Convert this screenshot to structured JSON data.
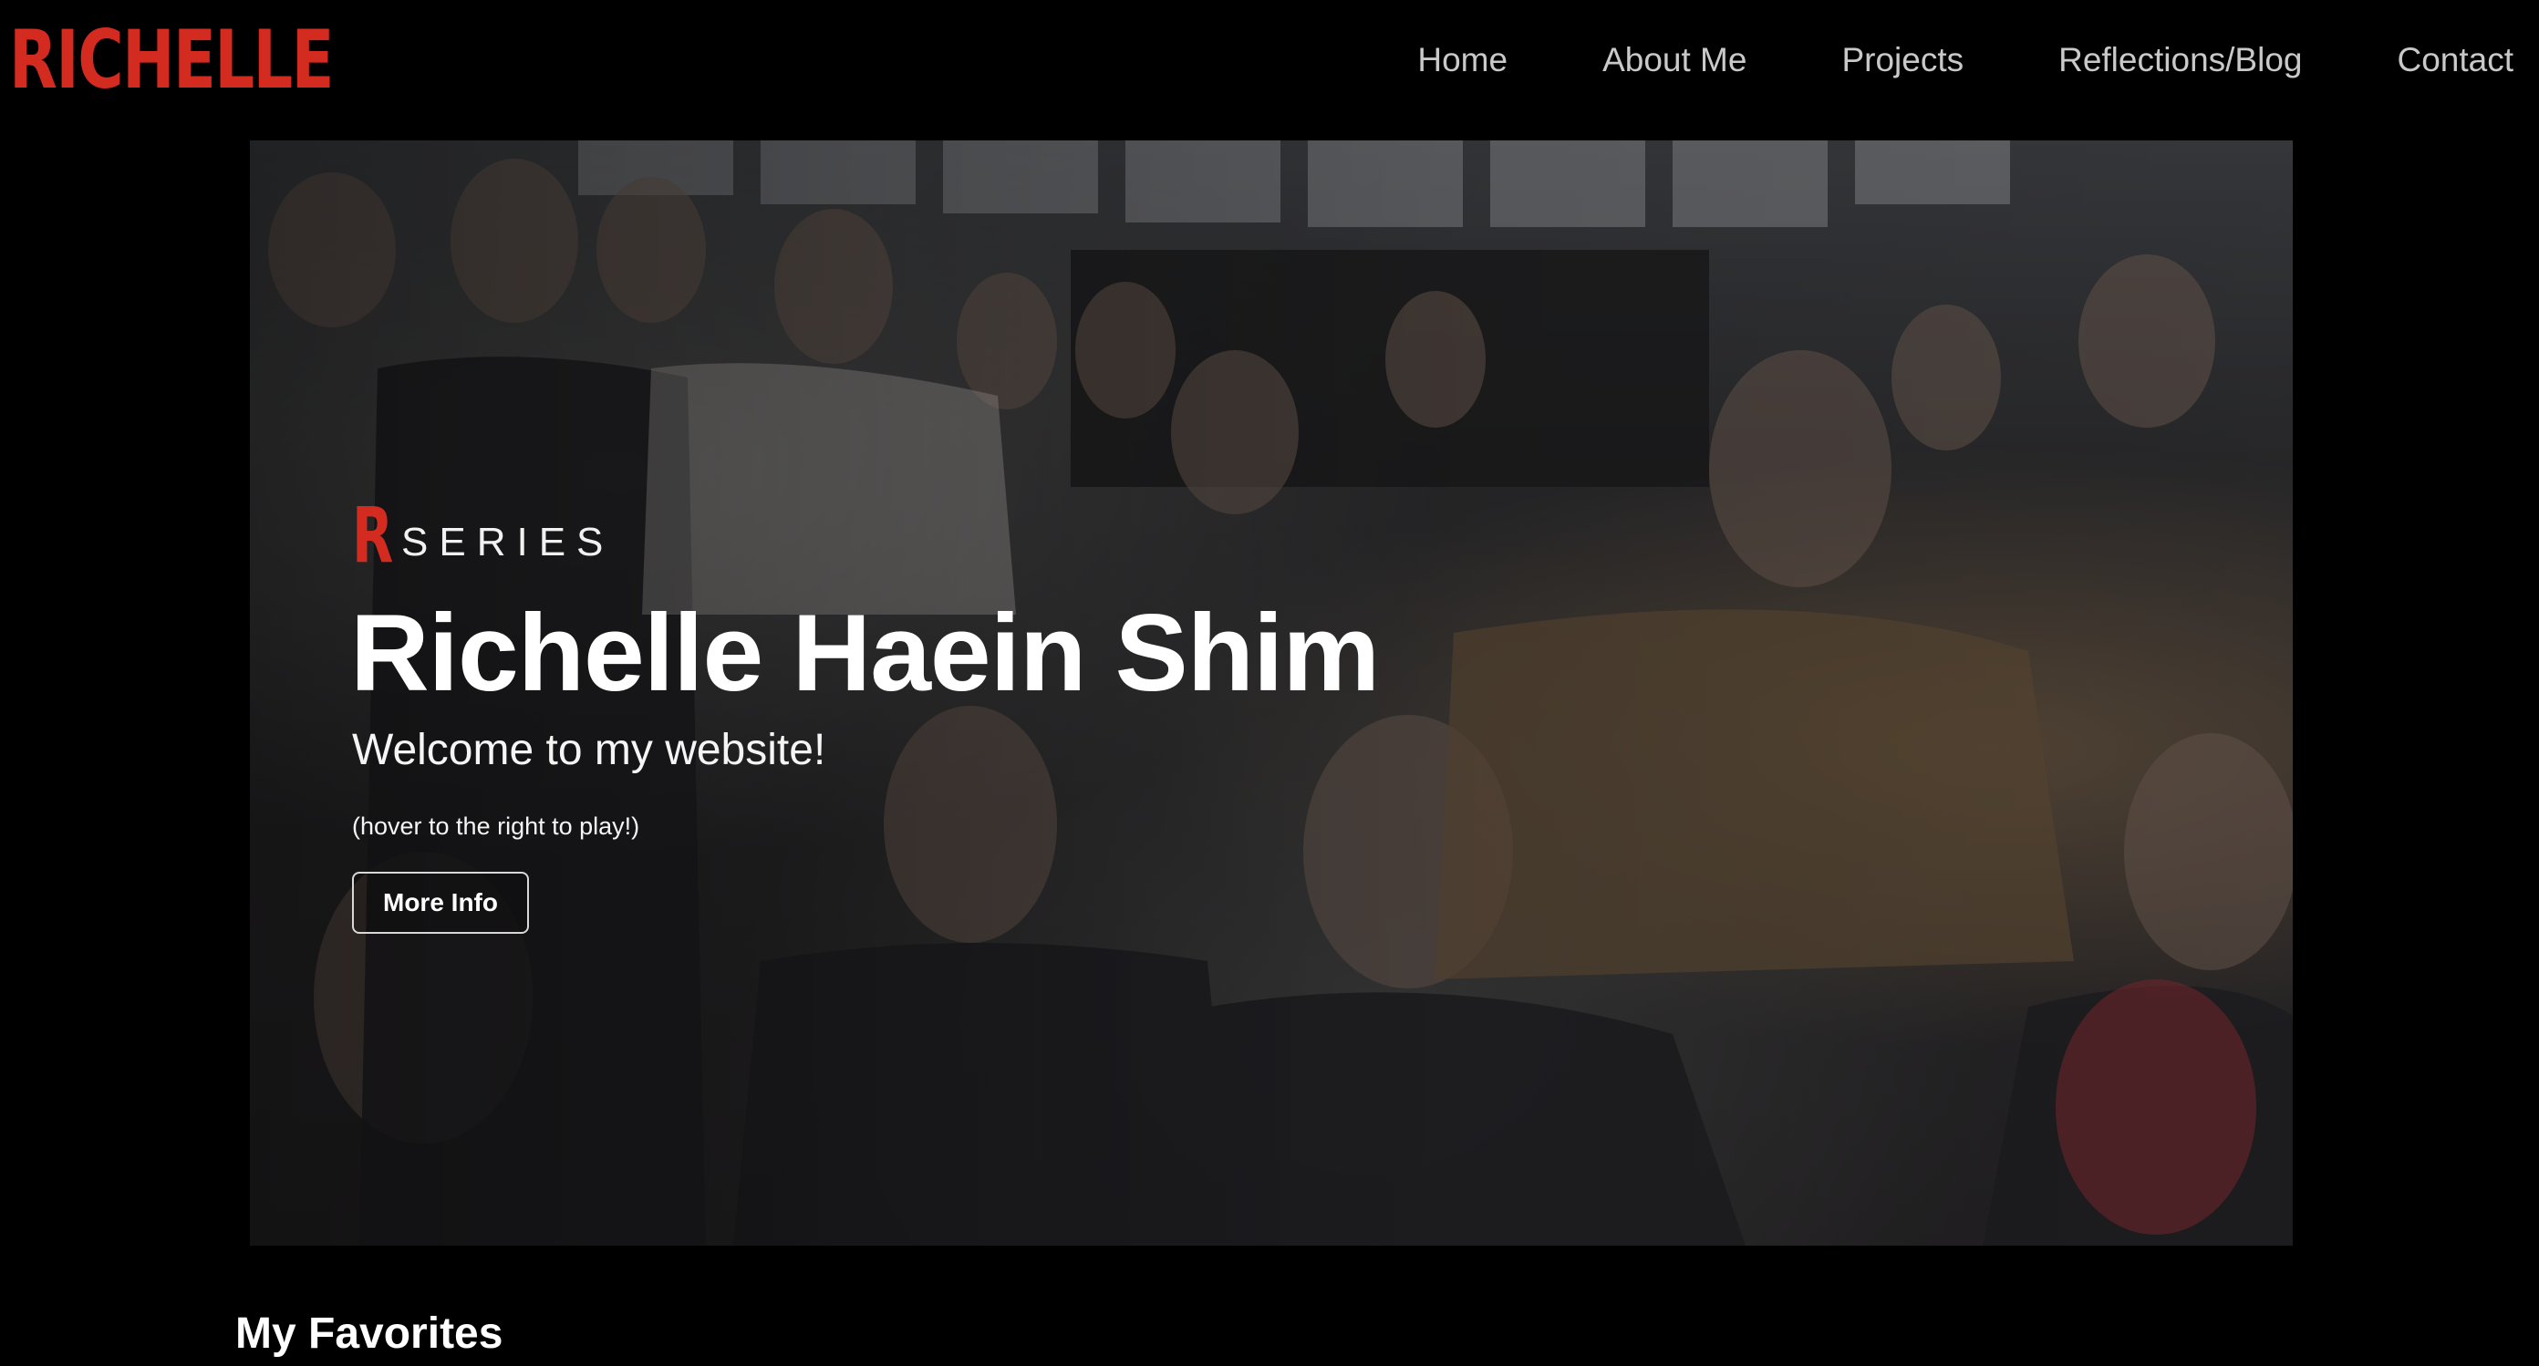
{
  "header": {
    "logo": "RICHELLE",
    "nav": [
      "Home",
      "About Me",
      "Projects",
      "Reflections/Blog",
      "Contact"
    ]
  },
  "hero": {
    "series_letter": "R",
    "series_word": "SERIES",
    "title": "Richelle Haein Shim",
    "subtitle": "Welcome to my website!",
    "hint": "(hover to the right to play!)",
    "button_label": "More Info"
  },
  "sections": {
    "favorites_title": "My Favorites"
  },
  "colors": {
    "accent": "#d42b20",
    "background": "#000000",
    "nav_text": "#c9c9c9"
  }
}
